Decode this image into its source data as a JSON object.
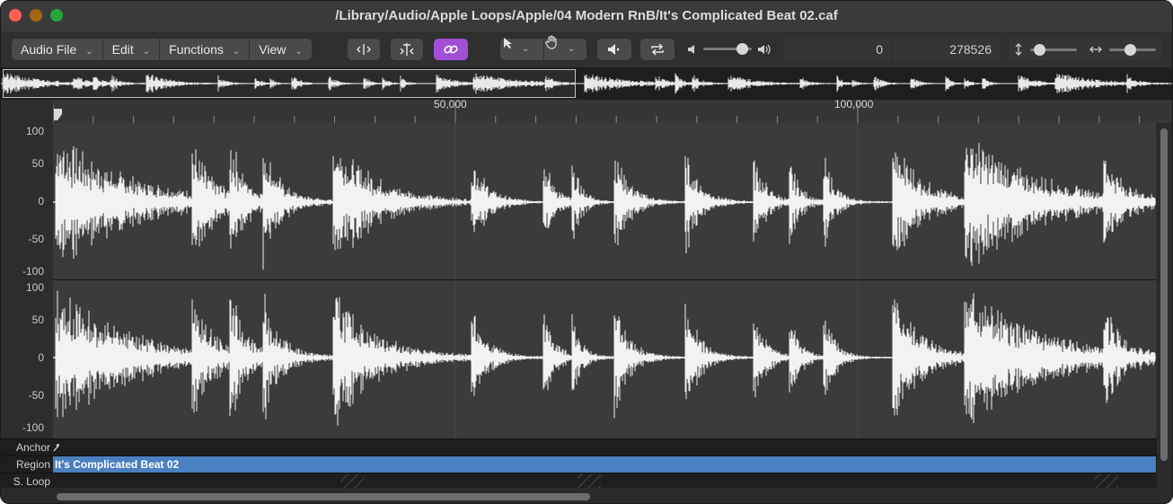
{
  "window": {
    "title": "/Library/Audio/Apple Loops/Apple/04 Modern RnB/It's Complicated Beat 02.caf"
  },
  "toolbar": {
    "menus": [
      {
        "label": "Audio File"
      },
      {
        "label": "Edit"
      },
      {
        "label": "Functions"
      },
      {
        "label": "View"
      }
    ],
    "icons": [
      "trim-icon",
      "split-icon",
      "link-icon",
      "pointer-tool-icon",
      "hand-tool-icon",
      "speaker-icon",
      "cycle-icon",
      "volume-low-icon",
      "volume-high-icon",
      "vertical-zoom-icon",
      "horizontal-zoom-icon"
    ],
    "link_active_color": "#a04fd6",
    "volume_level": 0.8,
    "selection_start": "0",
    "selection_end": "278526",
    "vertical_zoom": 0.2,
    "horizontal_zoom": 0.45
  },
  "ruler": {
    "labels": [
      "50,000",
      "100,000"
    ]
  },
  "channels": [
    {
      "y_labels": [
        "100",
        "50",
        "0",
        "-50",
        "-100"
      ]
    },
    {
      "y_labels": [
        "100",
        "50",
        "0",
        "-50",
        "-100"
      ]
    }
  ],
  "lanes": {
    "anchor_label": "Anchor",
    "region_label": "Region",
    "region_name": "It's Complicated Beat 02",
    "region_color": "#4a7fc0",
    "sloop_label": "S. Loop"
  }
}
